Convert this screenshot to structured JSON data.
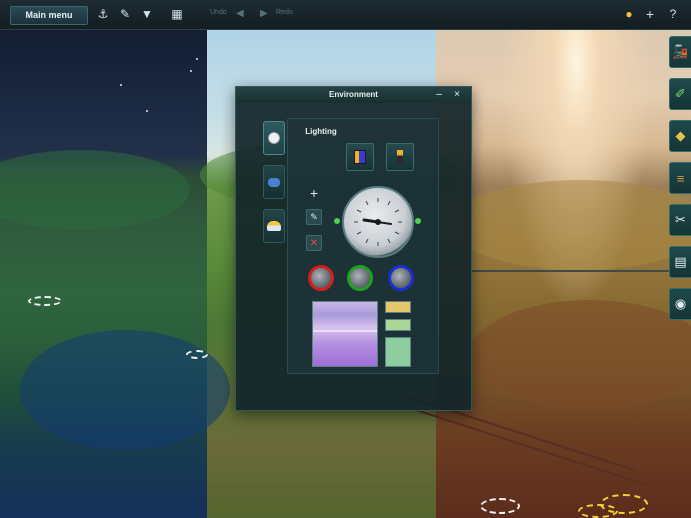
{
  "toolbar": {
    "main_menu_label": "Main menu",
    "undo_label": "Undo",
    "redo_label": "Redo",
    "icons": [
      "layout-tool-icon",
      "edit-icon",
      "filter-icon",
      "grid-icon"
    ]
  },
  "dialog": {
    "title": "Environment",
    "minimize_glyph": "–",
    "close_glyph": "×",
    "section_label": "Lighting",
    "side_tabs": [
      "clock-tab",
      "weather-tab",
      "sun-cloud-tab"
    ],
    "active_tab": "clock-tab",
    "color_wheels": [
      {
        "name": "red",
        "ring": "#d21e1e"
      },
      {
        "name": "green",
        "ring": "#1fa021"
      },
      {
        "name": "blue",
        "ring": "#1a2fd0"
      }
    ],
    "swatches": [
      {
        "color": "#e6c76a"
      },
      {
        "color": "#a9d696"
      },
      {
        "color": "#8ecda0"
      }
    ]
  },
  "colors": {
    "accent": "#2f6b6b",
    "dialog_bg": "#122428"
  }
}
